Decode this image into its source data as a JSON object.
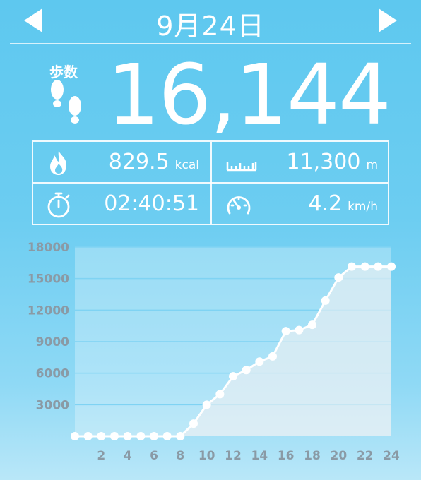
{
  "header": {
    "date": "9月24日"
  },
  "summary": {
    "steps_label": "歩数",
    "steps": "16,144",
    "calories": "829.5",
    "calories_unit": "kcal",
    "distance": "11,300",
    "distance_unit": "m",
    "duration": "02:40:51",
    "speed": "4.2",
    "speed_unit": "km/h"
  },
  "icons": [
    "left-arrow",
    "right-arrow",
    "footprints",
    "flame",
    "ruler",
    "stopwatch",
    "speedometer"
  ],
  "colors": {
    "background": "#5ec8ef",
    "line": "#ffffff",
    "fill": "#d7eaf0",
    "tick_text": "#8a9aa5"
  },
  "chart_data": {
    "type": "area",
    "x": [
      0,
      1,
      2,
      3,
      4,
      5,
      6,
      7,
      8,
      9,
      10,
      11,
      12,
      13,
      14,
      15,
      16,
      17,
      18,
      19,
      20,
      21,
      22,
      23,
      24
    ],
    "values": [
      0,
      0,
      0,
      0,
      0,
      0,
      0,
      0,
      0,
      1200,
      3000,
      4000,
      5700,
      6300,
      7100,
      7600,
      10000,
      10100,
      10600,
      12900,
      15100,
      16144,
      16144,
      16144,
      16144
    ],
    "x_ticks": [
      2,
      4,
      6,
      8,
      10,
      12,
      14,
      16,
      18,
      20,
      22,
      24
    ],
    "y_ticks": [
      3000,
      6000,
      9000,
      12000,
      15000,
      18000
    ],
    "ylim": [
      0,
      18000
    ],
    "xlim": [
      0,
      24
    ],
    "grid": true
  }
}
